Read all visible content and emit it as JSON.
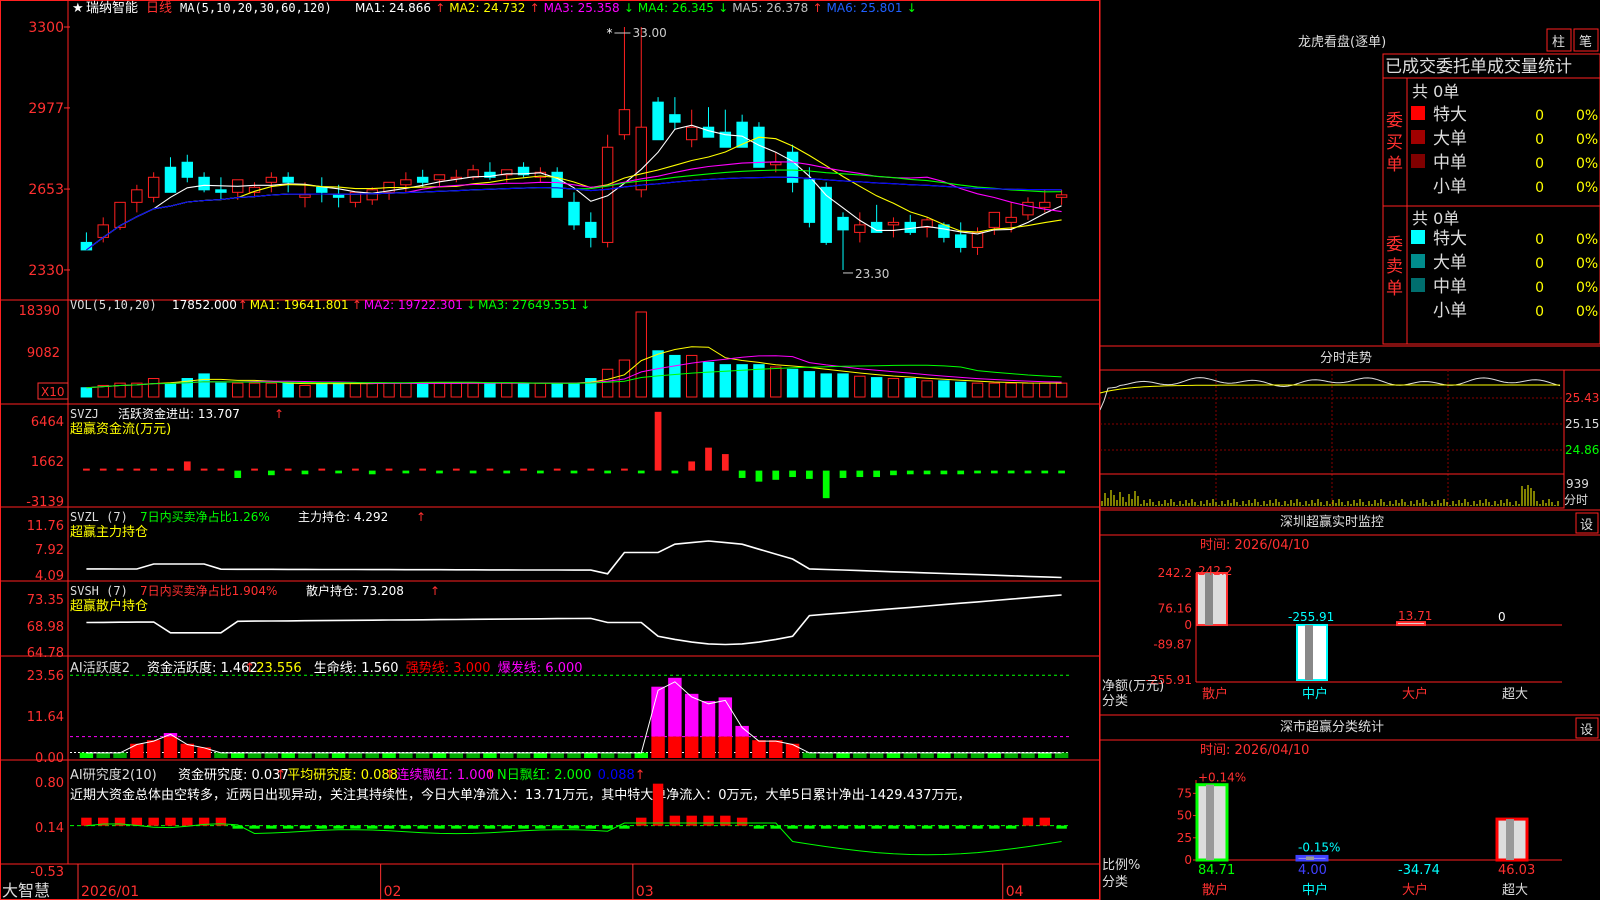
{
  "app": {
    "brand": "大智慧"
  },
  "colors": {
    "up": "#ff2020",
    "down": "#00ffff",
    "ma1": "#ffffff",
    "ma2": "#ffff00",
    "ma3": "#ff00ff",
    "ma4": "#00ff00",
    "ma5": "#a0a0a0",
    "ma6": "#0000ff",
    "grid": "#880000",
    "label": "#ff3030",
    "inflow_neg": "#00ff00"
  },
  "kline": {
    "star": "★",
    "stock_name": "瑞纳智能",
    "period": "日线",
    "ma_def": "MA(5,10,20,30,60,120)",
    "ma_items": [
      {
        "t": "MA1: 24.866",
        "arrow": "↑",
        "color": "#ffffff"
      },
      {
        "t": "MA2: 24.732",
        "arrow": "↑",
        "color": "#ffff00"
      },
      {
        "t": "MA3: 25.358",
        "arrow": "↓",
        "color": "#ff00ff"
      },
      {
        "t": "MA4: 26.345",
        "arrow": "↓",
        "color": "#00ff00"
      },
      {
        "t": "MA5: 26.378",
        "arrow": "↑",
        "color": "#c0c0c0"
      },
      {
        "t": "MA6: 25.801",
        "arrow": "↓",
        "color": "#2060ff"
      }
    ],
    "ylabels": [
      "3300",
      "2977",
      "2653",
      "2330"
    ],
    "ylim": [
      2250,
      3320
    ],
    "max_label": "33.00",
    "min_label": "23.30",
    "x_ticks": [
      {
        "i": 0,
        "label": "2026/01"
      },
      {
        "i": 18,
        "label": "02"
      },
      {
        "i": 33,
        "label": "03"
      },
      {
        "i": 55,
        "label": "04"
      }
    ]
  },
  "chart_data": [
    {
      "type": "candlestick",
      "title": "瑞纳智能 日线",
      "open": [
        2440,
        2460,
        2500,
        2600,
        2620,
        2740,
        2760,
        2700,
        2650,
        2640,
        2640,
        2680,
        2700,
        2620,
        2660,
        2630,
        2600,
        2610,
        2640,
        2670,
        2700,
        2690,
        2700,
        2700,
        2720,
        2710,
        2740,
        2700,
        2720,
        2600,
        2520,
        2440,
        2870,
        2650,
        3000,
        2950,
        2850,
        2900,
        2880,
        2920,
        2900,
        2750,
        2800,
        2690,
        2660,
        2540,
        2480,
        2520,
        2510,
        2520,
        2500,
        2510,
        2470,
        2420,
        2500,
        2520,
        2550,
        2580,
        2620
      ],
      "high": [
        2480,
        2540,
        2580,
        2670,
        2720,
        2780,
        2790,
        2720,
        2700,
        2680,
        2680,
        2720,
        2720,
        2680,
        2700,
        2670,
        2640,
        2660,
        2680,
        2720,
        2730,
        2710,
        2730,
        2750,
        2760,
        2730,
        2760,
        2740,
        2740,
        2640,
        2560,
        2870,
        3300,
        3300,
        3020,
        3020,
        2970,
        2980,
        2970,
        2950,
        2920,
        2800,
        2830,
        2740,
        2680,
        2560,
        2560,
        2590,
        2540,
        2550,
        2540,
        2520,
        2520,
        2500,
        2560,
        2600,
        2620,
        2650,
        2650
      ],
      "low": [
        2420,
        2440,
        2490,
        2560,
        2600,
        2640,
        2680,
        2640,
        2610,
        2610,
        2620,
        2640,
        2640,
        2580,
        2600,
        2580,
        2580,
        2590,
        2610,
        2640,
        2660,
        2660,
        2680,
        2690,
        2690,
        2680,
        2700,
        2680,
        2620,
        2490,
        2420,
        2420,
        2850,
        2620,
        2920,
        2890,
        2820,
        2860,
        2860,
        2820,
        2760,
        2720,
        2640,
        2500,
        2430,
        2330,
        2440,
        2480,
        2460,
        2470,
        2460,
        2440,
        2400,
        2390,
        2470,
        2480,
        2530,
        2560,
        2590
      ],
      "close": [
        2410,
        2510,
        2600,
        2650,
        2700,
        2640,
        2700,
        2650,
        2640,
        2690,
        2660,
        2700,
        2680,
        2630,
        2640,
        2620,
        2640,
        2650,
        2680,
        2690,
        2680,
        2710,
        2700,
        2730,
        2700,
        2730,
        2710,
        2720,
        2620,
        2510,
        2460,
        2820,
        2970,
        2900,
        2850,
        2920,
        2900,
        2860,
        2820,
        2820,
        2740,
        2760,
        2680,
        2520,
        2440,
        2490,
        2510,
        2480,
        2520,
        2480,
        2530,
        2460,
        2420,
        2480,
        2560,
        2540,
        2600,
        2600,
        2630
      ]
    },
    {
      "type": "bar",
      "title": "VOL(5,10,20)",
      "values": [
        2,
        2.5,
        3,
        3,
        4,
        3,
        4,
        5,
        3,
        3,
        3,
        3,
        3,
        2.5,
        3,
        3,
        3,
        3,
        3,
        3,
        3,
        3,
        3,
        3,
        3,
        3,
        3,
        3,
        3,
        3,
        4,
        6,
        8,
        18.4,
        10,
        9,
        9,
        7.5,
        7,
        7,
        7,
        6.5,
        6,
        5.5,
        5,
        5,
        4.5,
        4.2,
        4,
        4,
        3.5,
        3.5,
        3.2,
        3,
        3,
        3,
        3,
        3,
        3
      ],
      "series": [
        {
          "name": "VOL",
          "values": [
            17852.0
          ]
        },
        {
          "name": "MA1",
          "values": [
            19641.801
          ]
        },
        {
          "name": "MA2",
          "values": [
            19722.301
          ]
        },
        {
          "name": "MA3",
          "values": [
            27649.551
          ]
        }
      ],
      "ylabels": [
        "18390",
        "9082"
      ],
      "unit_label": "X10"
    },
    {
      "type": "bar",
      "title": "SVZJ 活跃资金进出",
      "values": [
        0,
        0,
        0,
        0,
        0,
        0,
        1000,
        0,
        0,
        -800,
        0,
        -500,
        0,
        -400,
        0,
        -300,
        0,
        -400,
        0,
        -300,
        0,
        -300,
        0,
        -300,
        0,
        -300,
        0,
        -300,
        0,
        -300,
        0,
        -300,
        0,
        -300,
        6400,
        -300,
        1000,
        2500,
        1800,
        -800,
        -1200,
        -1000,
        -700,
        -900,
        -3000,
        -800,
        -700,
        -700,
        -500,
        -400,
        -400,
        -400,
        -400,
        -300,
        -300,
        -300,
        -300,
        -300,
        -300
      ],
      "ylabels": [
        "6464",
        "1662",
        "-3139"
      ],
      "ylim": [
        -3200,
        6600
      ]
    }
  ],
  "volume": {
    "title": "VOL(5,10,20)",
    "items": [
      {
        "t": "17852.000",
        "arrow": "↑",
        "color": "#ffffff"
      },
      {
        "t": "MA1: 19641.801",
        "arrow": "↑",
        "color": "#ffff00"
      },
      {
        "t": "MA2: 19722.301",
        "arrow": "↓",
        "color": "#ff00ff"
      },
      {
        "t": "MA3: 27649.551",
        "arrow": "↓",
        "color": "#00ff00"
      }
    ],
    "ylabels": [
      "18390",
      "9082"
    ],
    "unit": "X10"
  },
  "svzj": {
    "name": "SVZJ",
    "item": "活跃资金进出: 13.707",
    "arrow": "↑",
    "sub": "超赢资金流(万元)",
    "ylabels": [
      "6464",
      "1662",
      "-3139"
    ]
  },
  "svzl": {
    "name": "SVZL (7)",
    "item1": "7日内买卖净占比1.26%",
    "item2": "主力持仓: 4.292",
    "arrow": "↑",
    "sub": "超赢主力持仓",
    "ylabels": [
      "11.76",
      "7.92",
      "4.09"
    ]
  },
  "svsh": {
    "name": "SVSH (7)",
    "item1": "7日内买卖净占比1.904%",
    "item2": "散户持仓: 73.208",
    "arrow": "↑",
    "sub": "超赢散户持仓",
    "ylabels": [
      "73.35",
      "68.98",
      "64.78"
    ]
  },
  "ai1": {
    "name": "AI活跃度2",
    "items": [
      {
        "t": "资金活跃度: 1.462",
        "arrow": "↑",
        "color": "#ffffff"
      },
      {
        "t": "23.556",
        "arrow": "",
        "color": "#ffff00"
      },
      {
        "t": "生命线: 1.560",
        "arrow": "",
        "color": "#ffffff"
      },
      {
        "t": "强势线: 3.000",
        "arrow": "",
        "color": "#ff0000"
      },
      {
        "t": "爆发线: 6.000",
        "arrow": "",
        "color": "#ff00ff"
      }
    ],
    "ylabels": [
      "23.56",
      "11.64",
      "0.00"
    ]
  },
  "ai2": {
    "name": "AI研究度2(10)",
    "items": [
      {
        "t": "资金研究度: 0.037",
        "arrow": "↑",
        "color": "#ffffff"
      },
      {
        "t": "平均研究度: 0.088",
        "arrow": "↑",
        "color": "#ffff00"
      },
      {
        "t": "连续飘红: 1.000",
        "arrow": "↑",
        "color": "#ff00ff"
      },
      {
        "t": "N日飘红: 2.000",
        "arrow": "",
        "color": "#00ff00"
      },
      {
        "t": "0.088",
        "arrow": "↑",
        "color": "#0000ff"
      }
    ],
    "note": "近期大资金总体由空转多，近两日出现异动，关注其持续性，今日大单净流入：13.71万元，其中特大单净流入：0万元，大单5日累计净出-1429.437万元，",
    "ylabels": [
      "0.80",
      "0.14",
      "-0.53"
    ]
  },
  "longhu": {
    "title": "龙虎看盘(逐单)",
    "btn1": "柱",
    "btn2": "笔",
    "header": "已成交委托单成交量统计",
    "buy": {
      "label": "委买单",
      "total": "共 0单",
      "rows": [
        {
          "name": "特大",
          "count": "0",
          "pct": "0%",
          "color": "#ff0000"
        },
        {
          "name": "大单",
          "count": "0",
          "pct": "0%",
          "color": "#a00000"
        },
        {
          "name": "中单",
          "count": "0",
          "pct": "0%",
          "color": "#800000"
        },
        {
          "name": "小单",
          "count": "0",
          "pct": "0%",
          "color": "#000000"
        }
      ]
    },
    "sell": {
      "label": "委卖单",
      "total": "共 0单",
      "rows": [
        {
          "name": "特大",
          "count": "0",
          "pct": "0%",
          "color": "#00ffff"
        },
        {
          "name": "大单",
          "count": "0",
          "pct": "0%",
          "color": "#008c8c"
        },
        {
          "name": "中单",
          "count": "0",
          "pct": "0%",
          "color": "#006e6e"
        },
        {
          "name": "小单",
          "count": "0",
          "pct": "0%",
          "color": "#000000"
        }
      ]
    }
  },
  "fenshi": {
    "title": "分时走势",
    "ylabels": [
      "25.43",
      "25.15",
      "24.86"
    ],
    "vol_label": "939",
    "vol_sub": "分时"
  },
  "shenzhen": {
    "title": "深圳超赢实时监控",
    "settings": "设",
    "time": "时间: 2026/04/10",
    "ylabels": [
      "242.2",
      "76.16",
      "0",
      "-89.87",
      "-255.91"
    ],
    "axis_label1": "净额(万元)",
    "axis_label2": "分类",
    "cats": [
      {
        "name": "散户",
        "value": 242.2,
        "label": "242.2",
        "color": "#ff3030"
      },
      {
        "name": "中户",
        "value": -255.91,
        "label": "-255.91",
        "color": "#00ffff"
      },
      {
        "name": "大户",
        "value": 13.71,
        "label": "13.71",
        "color": "#ff3030"
      },
      {
        "name": "超大",
        "value": 0,
        "label": "0",
        "color": "#ffffff"
      }
    ]
  },
  "shenshi": {
    "title": "深市超赢分类统计",
    "settings": "设",
    "time": "时间: 2026/04/10",
    "ylabels": [
      "75",
      "50",
      "25",
      "0"
    ],
    "axis_label1": "比例%",
    "axis_label2": "分类",
    "cats": [
      {
        "name": "散户",
        "value": 84.71,
        "top": "+0.14%",
        "bottom": "84.71",
        "top_color": "#ff3030",
        "bottom_color": "#00ff00"
      },
      {
        "name": "中户",
        "value": 4.0,
        "top": "-0.15%",
        "bottom": "4.00",
        "top_color": "#00ffff",
        "bottom_color": "#4040ff"
      },
      {
        "name": "大户",
        "value": 0,
        "top": "",
        "bottom": "-34.74",
        "top_color": "#ffffff",
        "bottom_color": "#00ffff"
      },
      {
        "name": "超大",
        "value": 46.03,
        "top": "",
        "bottom": "46.03",
        "top_color": "#ffffff",
        "bottom_color": "#ff3030"
      }
    ]
  }
}
